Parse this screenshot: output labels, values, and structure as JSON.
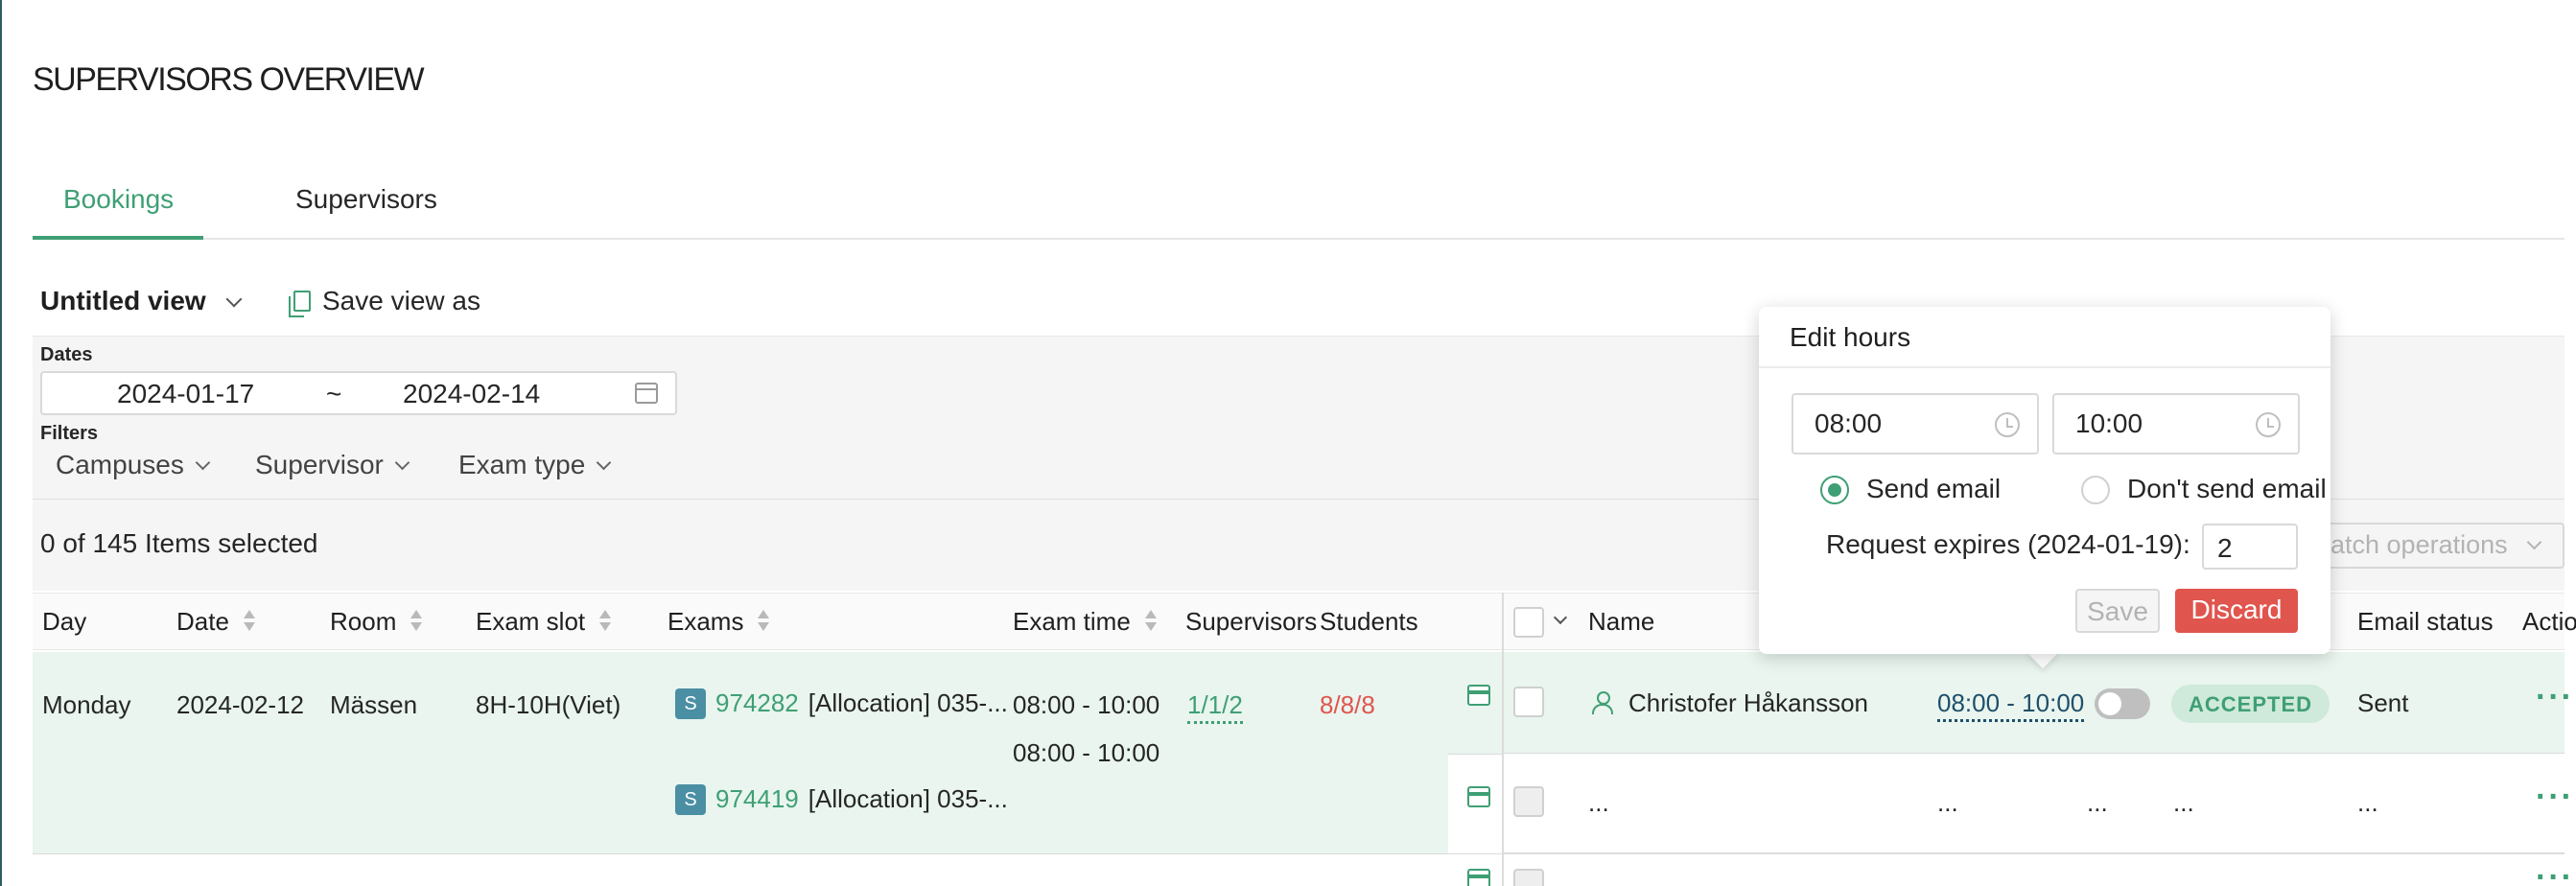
{
  "page_title": "SUPERVISORS OVERVIEW",
  "tabs": [
    {
      "label": "Bookings",
      "active": true
    },
    {
      "label": "Supervisors",
      "active": false
    }
  ],
  "view": {
    "name": "Untitled view",
    "save_as_label": "Save view as"
  },
  "filters": {
    "dates_label": "Dates",
    "date_start": "2024-01-17",
    "date_separator": "~",
    "date_end": "2024-02-14",
    "filters_label": "Filters",
    "items": [
      "Campuses",
      "Supervisor",
      "Exam type"
    ]
  },
  "selection": {
    "count_text": "0 of 145 Items selected",
    "batch_label": "Batch operations"
  },
  "table": {
    "columns": {
      "day": "Day",
      "date": "Date",
      "room": "Room",
      "exam_slot": "Exam slot",
      "exams": "Exams",
      "exam_time": "Exam time",
      "supervisors": "Supervisors",
      "students": "Students",
      "name": "Name",
      "email_status": "Email status",
      "actions": "Actio"
    },
    "row": {
      "day": "Monday",
      "date": "2024-02-12",
      "room": "Mässen",
      "exam_slot": "8H-10H(Viet)",
      "exams": [
        {
          "badge": "S",
          "code": "974282",
          "title": "[Allocation] 035-..."
        },
        {
          "badge": "S",
          "code": "974419",
          "title": "[Allocation] 035-..."
        }
      ],
      "exam_times": [
        "08:00 - 10:00",
        "08:00 - 10:00"
      ],
      "supervisors": "1/1/2",
      "students": "8/8/8"
    },
    "supervisor_rows": [
      {
        "name": "Christofer Håkansson",
        "hours": "08:00 - 10:00",
        "status": "ACCEPTED",
        "email_status": "Sent",
        "actions": "···"
      },
      {
        "name": "...",
        "hours": "...",
        "extra1": "...",
        "extra2": "...",
        "email_status": "...",
        "actions": "···"
      }
    ]
  },
  "popover": {
    "title": "Edit hours",
    "start_time": "08:00",
    "end_time": "10:00",
    "send_email_label": "Send email",
    "dont_send_label": "Don't send email",
    "expires_label": "Request expires (2024-01-19):",
    "expires_value": "2",
    "save_label": "Save",
    "discard_label": "Discard"
  },
  "colors": {
    "accent": "#3f9f74",
    "danger": "#e0554e",
    "row_highlight": "#e9f5ee",
    "badge": "#4a8fa3"
  }
}
